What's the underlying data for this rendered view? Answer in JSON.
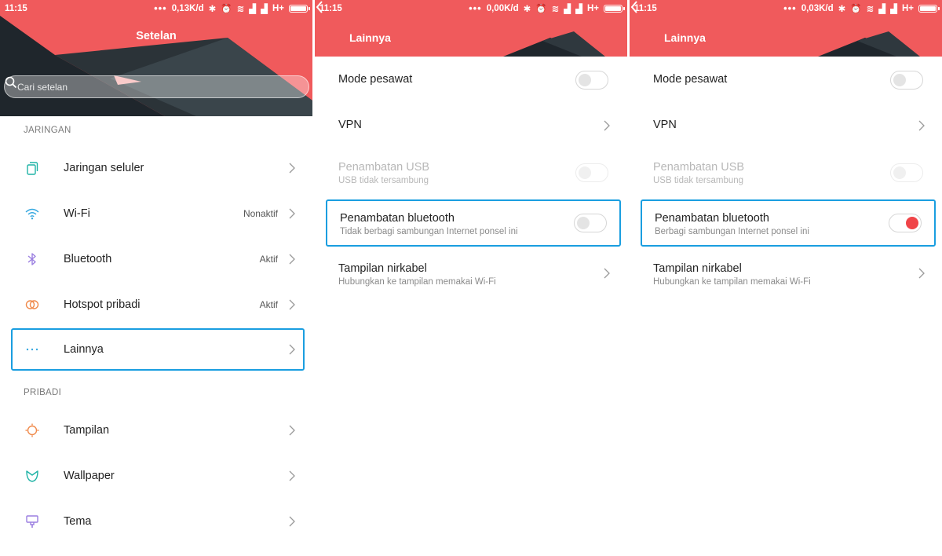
{
  "screens": [
    {
      "status": {
        "time": "11:15",
        "speed": "0,13K/d",
        "network": "H+"
      },
      "title": "Setelan",
      "search_placeholder": "Cari setelan",
      "sections": [
        {
          "header": "JARINGAN",
          "items": [
            {
              "label": "Jaringan seluler",
              "value": "",
              "icon": "sim-cards-icon"
            },
            {
              "label": "Wi-Fi",
              "value": "Nonaktif",
              "icon": "wifi-icon"
            },
            {
              "label": "Bluetooth",
              "value": "Aktif",
              "icon": "bluetooth-icon"
            },
            {
              "label": "Hotspot pribadi",
              "value": "Aktif",
              "icon": "hotspot-icon"
            },
            {
              "label": "Lainnya",
              "value": "",
              "icon": "more-dots-icon",
              "highlighted": true
            }
          ]
        },
        {
          "header": "PRIBADI",
          "items": [
            {
              "label": "Tampilan",
              "value": "",
              "icon": "display-sun-icon"
            },
            {
              "label": "Wallpaper",
              "value": "",
              "icon": "wallpaper-flower-icon"
            },
            {
              "label": "Tema",
              "value": "",
              "icon": "theme-brush-icon"
            }
          ]
        }
      ]
    },
    {
      "status": {
        "time": "11:15",
        "speed": "0,00K/d",
        "network": "H+"
      },
      "title": "Lainnya",
      "items": [
        {
          "label": "Mode pesawat",
          "sub": "",
          "control": "toggle",
          "on": false,
          "disabled": false
        },
        {
          "label": "VPN",
          "sub": "",
          "control": "chevron"
        },
        {
          "label": "Penambatan USB",
          "sub": "USB tidak tersambung",
          "control": "toggle",
          "on": false,
          "disabled": true
        },
        {
          "label": "Penambatan bluetooth",
          "sub": "Tidak berbagi sambungan Internet ponsel ini",
          "control": "toggle",
          "on": false,
          "disabled": false,
          "highlighted": true
        },
        {
          "label": "Tampilan nirkabel",
          "sub": "Hubungkan ke tampilan memakai Wi-Fi",
          "control": "chevron"
        }
      ]
    },
    {
      "status": {
        "time": "11:15",
        "speed": "0,03K/d",
        "network": "H+"
      },
      "title": "Lainnya",
      "items": [
        {
          "label": "Mode pesawat",
          "sub": "",
          "control": "toggle",
          "on": false,
          "disabled": false
        },
        {
          "label": "VPN",
          "sub": "",
          "control": "chevron"
        },
        {
          "label": "Penambatan USB",
          "sub": "USB tidak tersambung",
          "control": "toggle",
          "on": false,
          "disabled": true
        },
        {
          "label": "Penambatan bluetooth",
          "sub": "Berbagi sambungan Internet ponsel ini",
          "control": "toggle",
          "on": true,
          "disabled": false,
          "highlighted": true
        },
        {
          "label": "Tampilan nirkabel",
          "sub": "Hubungkan ke tampilan memakai Wi-Fi",
          "control": "chevron"
        }
      ]
    }
  ],
  "colors": {
    "header": "#f05a5c",
    "dark": "#222a30",
    "highlight": "#1a9ee0",
    "toggle_on": "#f04448",
    "icon_teal": "#1fb3a6",
    "icon_blue": "#35a8e0",
    "icon_purple": "#9b7fe0",
    "icon_orange": "#f08a4b"
  }
}
